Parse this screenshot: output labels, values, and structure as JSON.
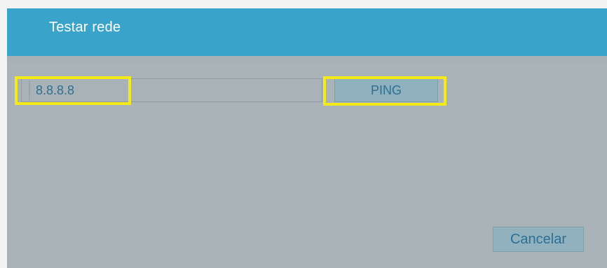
{
  "dialog": {
    "title": "Testar rede"
  },
  "ping": {
    "ip_value": "8.8.8.8",
    "button_label": "PING"
  },
  "footer": {
    "cancel_label": "Cancelar"
  },
  "colors": {
    "title_bar": "#3aa3c9",
    "dialog_background": "#aab3b7",
    "highlight": "#f3ea18",
    "button_background": "#8fb0bd",
    "button_text": "#2e6f93"
  }
}
